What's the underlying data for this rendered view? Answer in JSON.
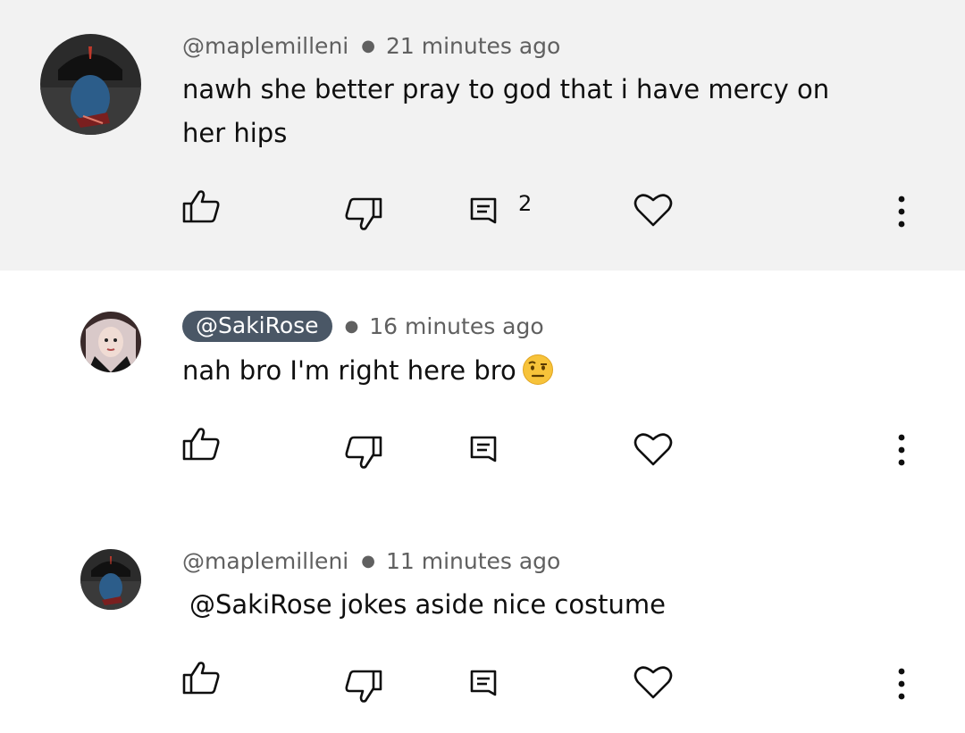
{
  "comments": [
    {
      "author": "@maplemilleni",
      "time": "21 minutes ago",
      "text": "nawh she better pray to god that i have mercy on her hips",
      "reply_count": "2",
      "highlighted": true,
      "author_is_creator": false
    },
    {
      "author": "@SakiRose",
      "time": "16 minutes ago",
      "text": "nah bro I'm right here bro",
      "emoji": "raised-eyebrow-face",
      "highlighted": false,
      "author_is_creator": true
    },
    {
      "author": "@maplemilleni",
      "time": "11 minutes ago",
      "mention": "@SakiRose",
      "text": "jokes aside nice costume",
      "highlighted": false,
      "author_is_creator": false
    }
  ],
  "actions": {
    "like": "thumbs-up-icon",
    "dislike": "thumbs-down-icon",
    "reply": "comment-icon",
    "heart": "heart-icon",
    "more": "more-vert-icon"
  },
  "colors": {
    "highlight_background": "#f2f2f2",
    "creator_pill": "#4a5766",
    "meta_text": "#606060",
    "body_text": "#0f0f0f"
  }
}
